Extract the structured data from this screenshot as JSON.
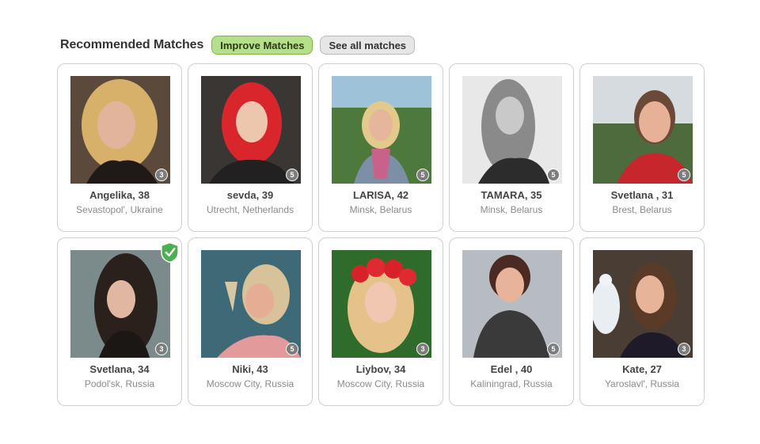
{
  "header": {
    "title": "Recommended Matches",
    "improve_label": "Improve Matches",
    "see_all_label": "See all matches"
  },
  "colors": {
    "improve_button_bg": "#b4e08b",
    "see_all_button_bg": "#e6e6e6",
    "verified_badge": "#4caf50"
  },
  "matches": [
    {
      "name": "Angelika",
      "age": "38",
      "display": "Angelika, 38",
      "location": "Sevastopol', Ukraine",
      "photos": "3",
      "verified": false
    },
    {
      "name": "sevda",
      "age": "39",
      "display": "sevda, 39",
      "location": "Utrecht, Netherlands",
      "photos": "5",
      "verified": false
    },
    {
      "name": "LARISA",
      "age": "42",
      "display": "LARISA, 42",
      "location": "Minsk, Belarus",
      "photos": "5",
      "verified": false
    },
    {
      "name": "TAMARA",
      "age": "35",
      "display": "TAMARA, 35",
      "location": "Minsk, Belarus",
      "photos": "5",
      "verified": false
    },
    {
      "name": "Svetlana ",
      "age": "31",
      "display": "Svetlana , 31",
      "location": "Brest, Belarus",
      "photos": "5",
      "verified": false
    },
    {
      "name": "Svetlana",
      "age": "34",
      "display": "Svetlana, 34",
      "location": "Podol'sk, Russia",
      "photos": "3",
      "verified": true
    },
    {
      "name": "Niki",
      "age": "43",
      "display": "Niki, 43",
      "location": "Moscow City, Russia",
      "photos": "5",
      "verified": false
    },
    {
      "name": "Liybov",
      "age": "34",
      "display": "Liybov, 34",
      "location": "Moscow City, Russia",
      "photos": "3",
      "verified": false
    },
    {
      "name": "Edel ",
      "age": "40",
      "display": "Edel , 40",
      "location": "Kaliningrad, Russia",
      "photos": "5",
      "verified": false
    },
    {
      "name": "Kate",
      "age": "27",
      "display": "Kate, 27",
      "location": "Yaroslavl', Russia",
      "photos": "3",
      "verified": false
    }
  ]
}
